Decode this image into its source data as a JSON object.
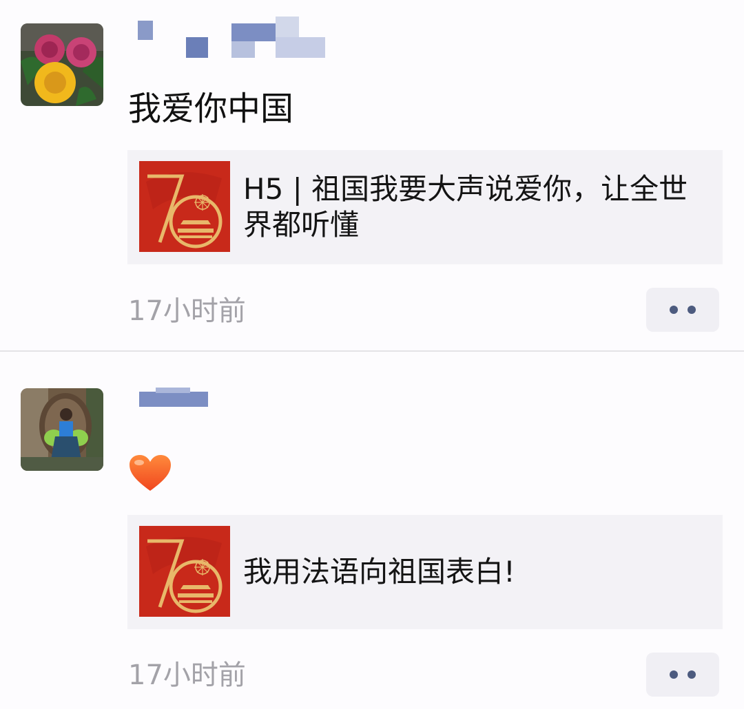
{
  "colors": {
    "background": "#fdfcfe",
    "card_background": "#f3f2f6",
    "timestamp_text": "#a3a2a8",
    "more_dots": "#4d5b7f",
    "thumb_red": "#c8291a",
    "thumb_gold": "#e8b86a"
  },
  "posts": [
    {
      "text": "我爱你中国",
      "link": {
        "title": "H5 | 祖国我要大声说爱你，让全世界都听懂",
        "thumbnail_icon": "70th-anniversary-emblem"
      },
      "time": "17小时前",
      "more_icon": "more-dots-icon"
    },
    {
      "emoji_icon": "orange-heart-icon",
      "link": {
        "title": "我用法语向祖国表白!",
        "thumbnail_icon": "70th-anniversary-emblem"
      },
      "time": "17小时前",
      "more_icon": "more-dots-icon"
    }
  ]
}
